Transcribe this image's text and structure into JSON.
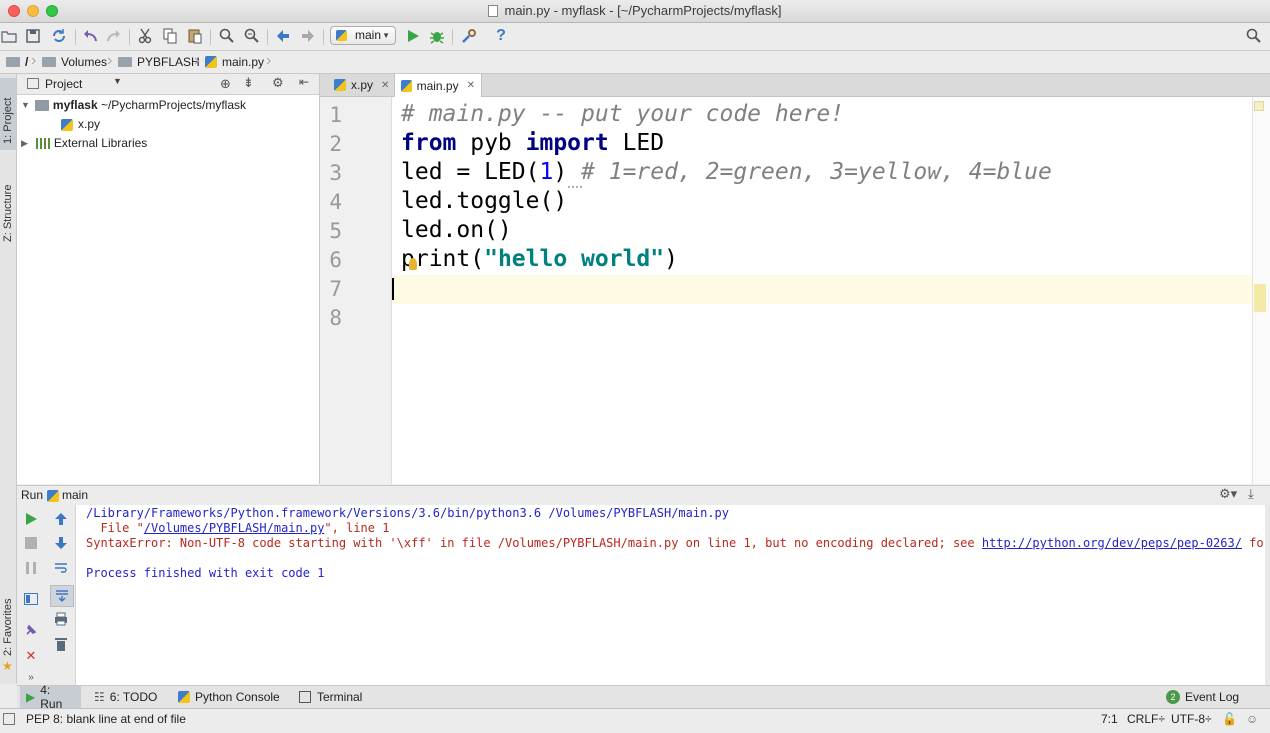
{
  "window": {
    "title": "main.py - myflask - [~/PycharmProjects/myflask]"
  },
  "toolbar": {
    "icons": [
      "open-folder-icon",
      "save-icon",
      "sync-icon",
      "undo-icon",
      "redo-icon",
      "cut-icon",
      "copy-icon",
      "paste-icon",
      "find-icon",
      "replace-icon",
      "back-icon",
      "forward-icon",
      "run-icon",
      "debug-icon",
      "settings-icon",
      "help-icon"
    ],
    "run_config": "main"
  },
  "breadcrumb": [
    "/",
    "Volumes",
    "PYBFLASH",
    "main.py"
  ],
  "left_stripe": {
    "project_tab": "1: Project",
    "structure_tab": "Z: Structure",
    "favorites_tab": "2: Favorites"
  },
  "project": {
    "header": "Project",
    "root_name": "myflask",
    "root_path": "~/PycharmProjects/myflask",
    "file": "x.py",
    "libraries": "External Libraries"
  },
  "editor": {
    "tabs": [
      "x.py",
      "main.py"
    ],
    "active_tab": "main.py",
    "line_numbers": [
      "1",
      "2",
      "3",
      "4",
      "5",
      "6",
      "7",
      "8"
    ],
    "code": {
      "l1_comment": "# main.py -- put your code here!",
      "l2_from": "from",
      "l2_mid": " pyb ",
      "l2_import": "import",
      "l2_end": " LED",
      "l3_start": "led = LED(",
      "l3_num": "1",
      "l3_close": ") ",
      "l3_comment": "# 1=red, 2=green, 3=yellow, 4=blue",
      "l4": "led.toggle()",
      "l5": "led.on()",
      "l6_start": "print(",
      "l6_str": "\"hello world\"",
      "l6_end": ")"
    }
  },
  "run_panel": {
    "label": "Run",
    "config": "main",
    "console": {
      "line1": "/Library/Frameworks/Python.framework/Versions/3.6/bin/python3.6 /Volumes/PYBFLASH/main.py",
      "line2_pre": "  File \"",
      "line2_link": "/Volumes/PYBFLASH/main.py",
      "line2_post": "\", line 1",
      "line3_pre": "SyntaxError: Non-UTF-8 code starting with '\\xff' in file /Volumes/PYBFLASH/main.py on line 1, but no encoding declared; see ",
      "line3_link": "http://python.org/dev/peps/pep-0263/",
      "line3_post": " for deta",
      "line4": "Process finished with exit code 1"
    }
  },
  "bottom_tabs": [
    {
      "label": "4: Run",
      "icon": "run-icon"
    },
    {
      "label": "6: TODO",
      "icon": "todo-icon"
    },
    {
      "label": "Python Console",
      "icon": "python-console-icon"
    },
    {
      "label": "Terminal",
      "icon": "terminal-icon"
    }
  ],
  "event_log": {
    "label": "Event Log",
    "count": "2"
  },
  "status_bar": {
    "message": "PEP 8: blank line at end of file",
    "position": "7:1",
    "line_separator": "CRLF÷",
    "encoding": "UTF-8÷"
  },
  "colors": {
    "keyword": "#000080",
    "comment": "#808080",
    "string": "#008080",
    "error": "#b8281f",
    "current_line": "#fffae3"
  }
}
